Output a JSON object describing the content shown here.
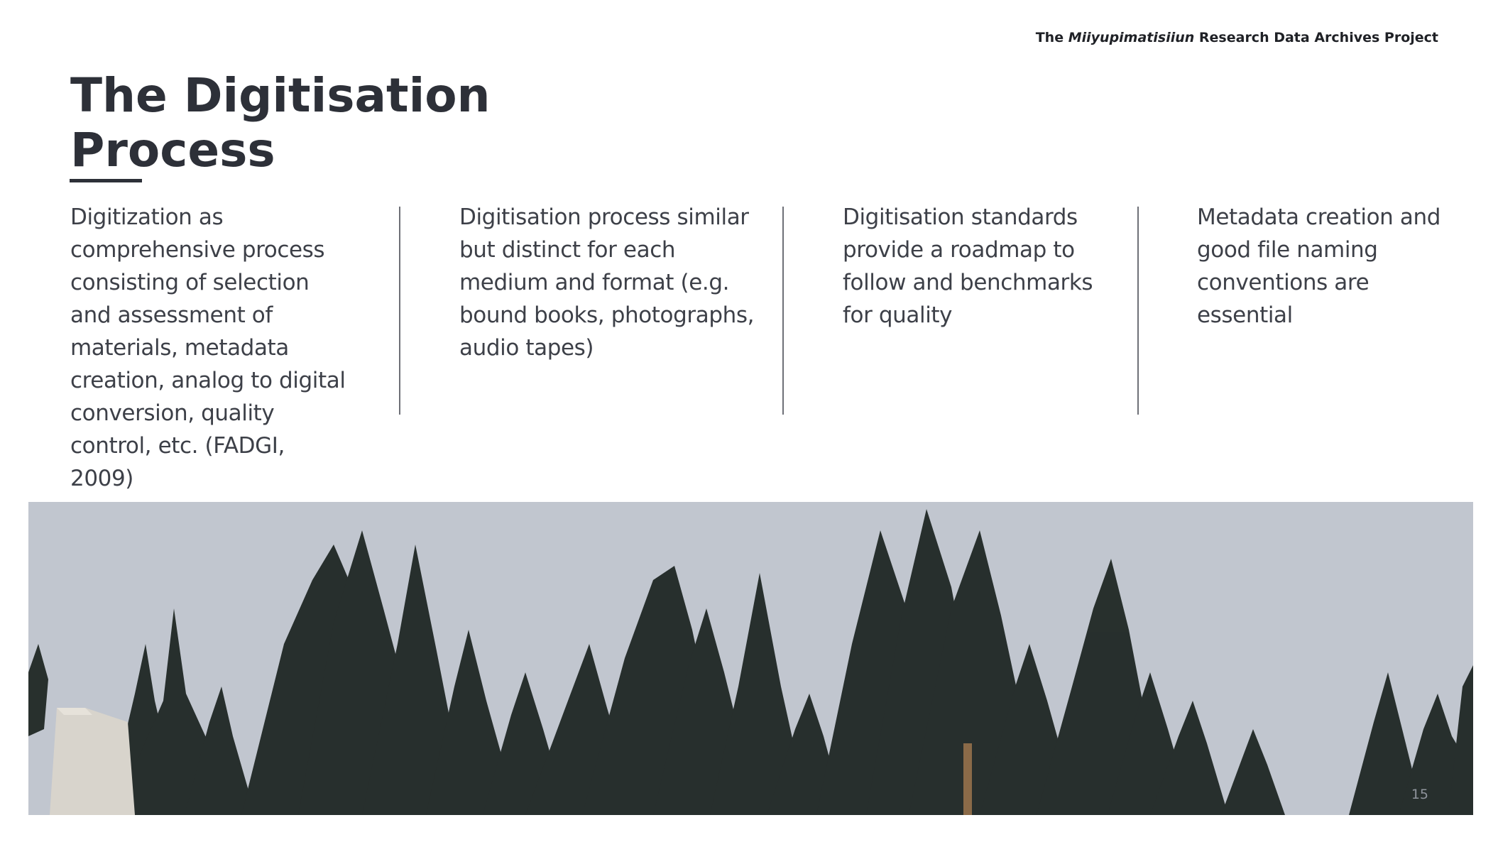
{
  "header": {
    "prefix": "The",
    "emphasis": "Miiyupimatisiiun",
    "suffix": "Research Data Archives Project"
  },
  "title": {
    "line1": "The Digitisation",
    "line2": "Process"
  },
  "columns": [
    {
      "text": "Digitization as comprehensive process consisting of selection and assessment of materials, metadata creation, analog to digital conversion, quality control, etc. (FADGI, 2009)"
    },
    {
      "text": "Digitisation process similar but distinct for each medium and format (e.g. bound books, photographs, audio tapes)"
    },
    {
      "text": "Digitisation standards provide a roadmap to follow and benchmarks for quality"
    },
    {
      "text": "Metadata creation and good file naming conventions are essential"
    }
  ],
  "photo": {
    "icon": "forest-photo",
    "sky_color": "#c1c6cf",
    "tree_color": "#1b2320"
  },
  "page_number": "15"
}
